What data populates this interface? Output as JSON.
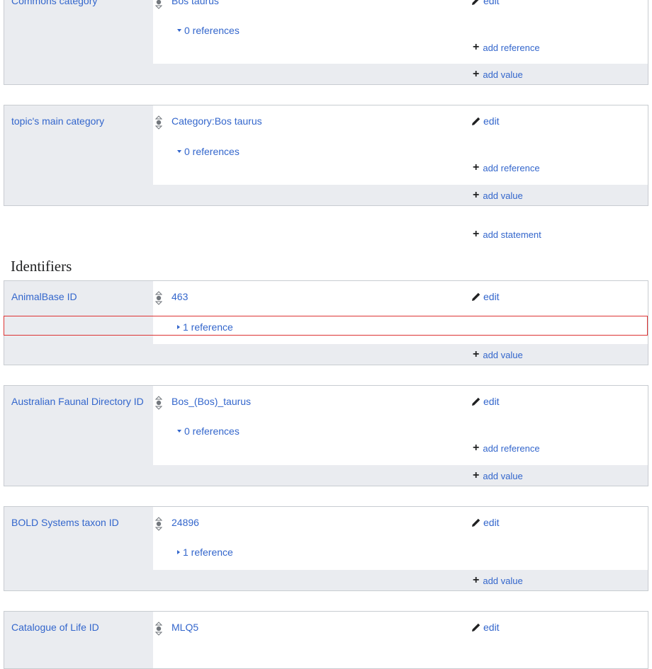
{
  "statements": [
    {
      "property": "Commons category",
      "value": "Bos taurus",
      "edit": "edit",
      "references": "0 references",
      "add_reference": "add reference",
      "add_value": "add value"
    },
    {
      "property": "topic's main category",
      "value": "Category:Bos taurus",
      "edit": "edit",
      "references": "0 references",
      "add_reference": "add reference",
      "add_value": "add value"
    }
  ],
  "add_statement": "add statement",
  "identifiers_heading": "Identifiers",
  "identifiers": [
    {
      "property": "AnimalBase ID",
      "value": "463",
      "edit": "edit",
      "references": "1 reference",
      "add_value": "add value"
    },
    {
      "property": "Australian Faunal Directory ID",
      "value": "Bos_(Bos)_taurus",
      "edit": "edit",
      "references": "0 references",
      "add_reference": "add reference",
      "add_value": "add value"
    },
    {
      "property": "BOLD Systems taxon ID",
      "value": "24896",
      "edit": "edit",
      "references": "1 reference",
      "add_value": "add value"
    },
    {
      "property": "Catalogue of Life ID",
      "value": "MLQ5",
      "edit": "edit"
    }
  ],
  "colors": {
    "link": "#3366cc",
    "panel_bg": "#eaecf0",
    "border": "#c8ccd1",
    "highlight": "#dd3333"
  },
  "icons": [
    "rank-normal-icon",
    "pencil-icon",
    "plus-icon",
    "expand-triangle-icon",
    "collapse-triangle-icon"
  ]
}
